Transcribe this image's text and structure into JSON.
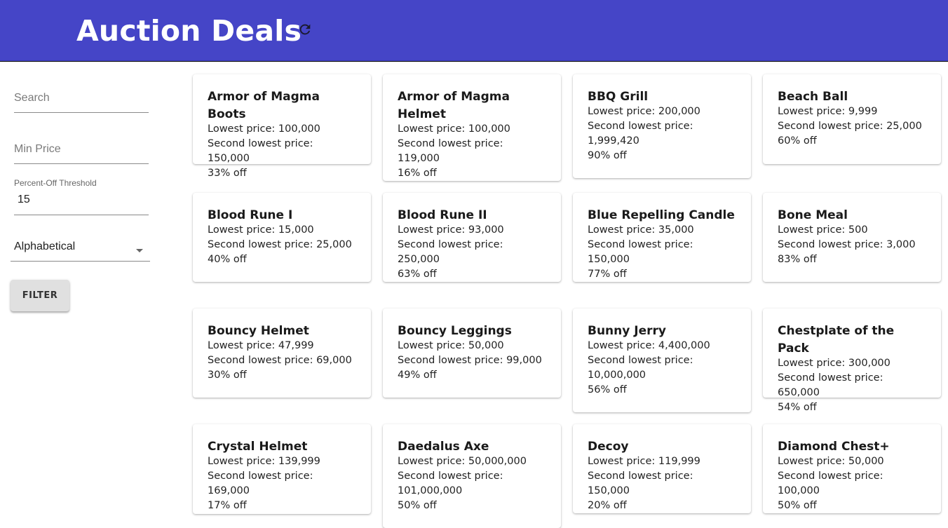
{
  "header": {
    "title": "Auction Deals",
    "refresh_icon": "refresh-icon"
  },
  "colors": {
    "app_bar": "#4545c7",
    "button_bg": "#e0e0e0"
  },
  "filters": {
    "search_placeholder": "Search",
    "min_price_placeholder": "Min Price",
    "threshold_label": "Percent-Off Threshold",
    "threshold_value": "15",
    "sort_value": "Alphabetical",
    "filter_button": "FILTER"
  },
  "cards": [
    {
      "name": "Armor of Magma Boots",
      "lowest": "Lowest price: 100,000",
      "second": "Second lowest price: 150,000",
      "off": "33% off"
    },
    {
      "name": "Armor of Magma Helmet",
      "lowest": "Lowest price: 100,000",
      "second": "Second lowest price: 119,000",
      "off": "16% off"
    },
    {
      "name": "BBQ Grill",
      "lowest": "Lowest price: 200,000",
      "second": "Second lowest price: 1,999,420",
      "off": "90% off"
    },
    {
      "name": "Beach Ball",
      "lowest": "Lowest price: 9,999",
      "second": "Second lowest price: 25,000",
      "off": "60% off"
    },
    {
      "name": "Blood Rune I",
      "lowest": "Lowest price: 15,000",
      "second": "Second lowest price: 25,000",
      "off": "40% off"
    },
    {
      "name": "Blood Rune II",
      "lowest": "Lowest price: 93,000",
      "second": "Second lowest price: 250,000",
      "off": "63% off"
    },
    {
      "name": "Blue Repelling Candle",
      "lowest": "Lowest price: 35,000",
      "second": "Second lowest price: 150,000",
      "off": "77% off"
    },
    {
      "name": "Bone Meal",
      "lowest": "Lowest price: 500",
      "second": "Second lowest price: 3,000",
      "off": "83% off"
    },
    {
      "name": "Bouncy Helmet",
      "lowest": "Lowest price: 47,999",
      "second": "Second lowest price: 69,000",
      "off": "30% off"
    },
    {
      "name": "Bouncy Leggings",
      "lowest": "Lowest price: 50,000",
      "second": "Second lowest price: 99,000",
      "off": "49% off"
    },
    {
      "name": "Bunny Jerry",
      "lowest": "Lowest price: 4,400,000",
      "second": "Second lowest price: 10,000,000",
      "off": "56% off"
    },
    {
      "name": "Chestplate of the Pack",
      "lowest": "Lowest price: 300,000",
      "second": "Second lowest price: 650,000",
      "off": "54% off"
    },
    {
      "name": "Crystal Helmet",
      "lowest": "Lowest price: 139,999",
      "second": "Second lowest price: 169,000",
      "off": "17% off"
    },
    {
      "name": "Daedalus Axe",
      "lowest": "Lowest price: 50,000,000",
      "second": "Second lowest price: 101,000,000",
      "off": "50% off"
    },
    {
      "name": "Decoy",
      "lowest": "Lowest price: 119,999",
      "second": "Second lowest price: 150,000",
      "off": "20% off"
    },
    {
      "name": "Diamond Chest+",
      "lowest": "Lowest price: 50,000",
      "second": "Second lowest price: 100,000",
      "off": "50% off"
    }
  ]
}
